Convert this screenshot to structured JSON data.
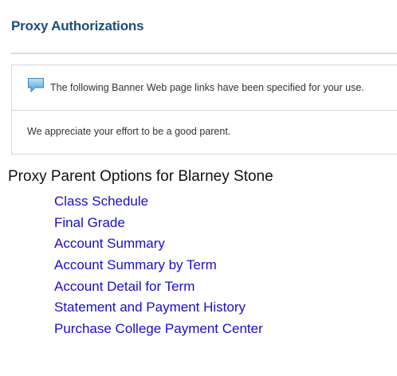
{
  "page": {
    "title": "Proxy Authorizations"
  },
  "info_box": {
    "icon": "speech-bubble-icon",
    "message": "The following Banner Web page links have been specified for your use.",
    "notice": "We appreciate your effort to be a good parent."
  },
  "options": {
    "heading": "Proxy Parent Options for Blarney Stone",
    "links": [
      {
        "label": "Class Schedule"
      },
      {
        "label": "Final Grade"
      },
      {
        "label": "Account Summary"
      },
      {
        "label": "Account Summary by Term"
      },
      {
        "label": "Account Detail for Term"
      },
      {
        "label": "Statement and Payment History"
      },
      {
        "label": "Purchase College Payment Center"
      }
    ]
  },
  "colors": {
    "title": "#1f4e79",
    "link": "#1a0dcc",
    "border": "#d3d7dc"
  }
}
